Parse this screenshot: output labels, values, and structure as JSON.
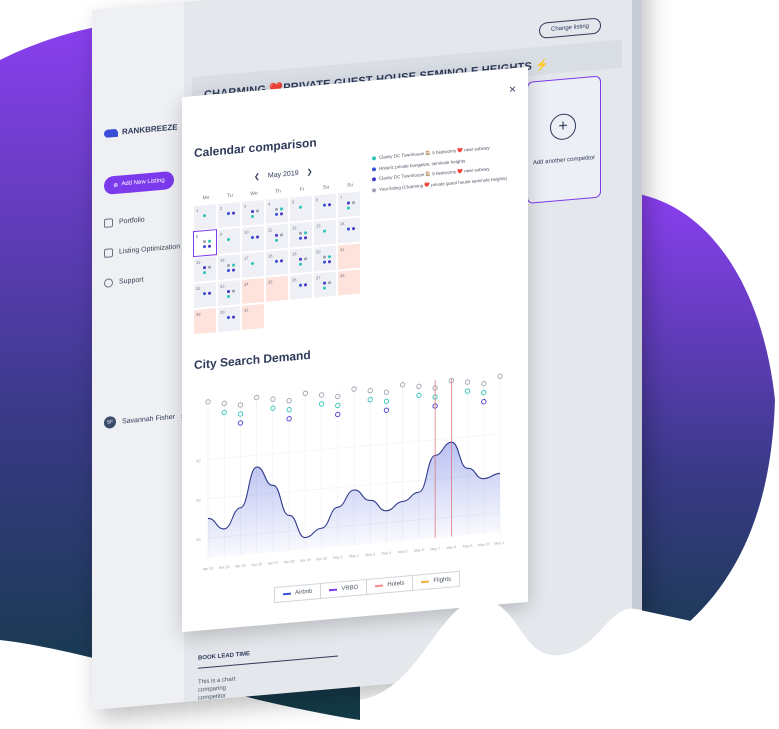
{
  "colors": {
    "purple_blob": "#7c3aed",
    "dark_blob": "#1e3a4a",
    "accent": "#7c3aed",
    "text": "#2e3a59",
    "booked": "#fde3dc",
    "dot_teal": "#2ec4b6",
    "dot_blue": "#3a4fd8",
    "dot_indigo": "#4338ca",
    "dot_gray": "#9ca3af"
  },
  "app": {
    "brand": "RANKBREEZE",
    "listing_title": "CHARMING ❤️PRIVATE GUEST HOUSE SEMINOLE HEIGHTS ⚡",
    "change_listing": "Change listing",
    "add_competitor": "Add another competitor"
  },
  "sidebar": {
    "add_listing": "Add New Listing",
    "items": [
      {
        "label": "Portfolio",
        "icon": "home-icon"
      },
      {
        "label": "Listing Optimization",
        "icon": "trend-icon"
      },
      {
        "label": "Support",
        "icon": "help-icon"
      }
    ],
    "user": {
      "initials": "SF",
      "name": "Savannah Fisher"
    }
  },
  "book_lead": {
    "title": "BOOK LEAD TIME",
    "text": "This is a chart comparing competitor with your listing."
  },
  "modal": {
    "close": "×",
    "calendar_title": "Calendar comparison",
    "month_label": "May 2019",
    "prev": "❮",
    "next": "❯",
    "weekdays": [
      "Mo",
      "Tu",
      "We",
      "Th",
      "Fr",
      "Sa",
      "Su"
    ],
    "days": [
      {
        "n": "1",
        "s": "p"
      },
      {
        "n": "2",
        "s": "p"
      },
      {
        "n": "3",
        "s": "p"
      },
      {
        "n": "4",
        "s": "p"
      },
      {
        "n": "5",
        "s": "p"
      },
      {
        "n": "6",
        "s": "p"
      },
      {
        "n": "7",
        "s": "p"
      },
      {
        "n": "8",
        "s": "sel"
      },
      {
        "n": "9",
        "s": "p"
      },
      {
        "n": "10",
        "s": "p"
      },
      {
        "n": "11",
        "s": "p"
      },
      {
        "n": "12",
        "s": "p"
      },
      {
        "n": "13",
        "s": "p"
      },
      {
        "n": "14",
        "s": "p"
      },
      {
        "n": "15",
        "s": "p"
      },
      {
        "n": "16",
        "s": "p"
      },
      {
        "n": "17",
        "s": "p"
      },
      {
        "n": "18",
        "s": "p"
      },
      {
        "n": "19",
        "s": "p"
      },
      {
        "n": "20",
        "s": "p"
      },
      {
        "n": "21",
        "s": "b"
      },
      {
        "n": "22",
        "s": "p"
      },
      {
        "n": "23",
        "s": "p"
      },
      {
        "n": "24",
        "s": "b"
      },
      {
        "n": "25",
        "s": "b"
      },
      {
        "n": "26",
        "s": "p"
      },
      {
        "n": "27",
        "s": "p"
      },
      {
        "n": "28",
        "s": "b"
      },
      {
        "n": "29",
        "s": "b"
      },
      {
        "n": "30",
        "s": "p"
      },
      {
        "n": "31",
        "s": "b"
      },
      {
        "n": "",
        "s": "e"
      },
      {
        "n": "",
        "s": "e"
      },
      {
        "n": "",
        "s": "e"
      },
      {
        "n": "",
        "s": "e"
      }
    ],
    "legend": [
      {
        "label": "Classy DC Townhouse 🏠 5 bedrooms ❤️ near subway",
        "color": "#2ec4b6"
      },
      {
        "label": "Historic private bungalow, seminole heights",
        "color": "#3a4fd8"
      },
      {
        "label": "Classy DC Townhouse 🏠 5 bedrooms ❤️ near subway",
        "color": "#4338ca"
      },
      {
        "label": "Your listing (Charming ❤️ private guest house seminole heights)",
        "color": "#9ca3af"
      }
    ],
    "demand_title": "City Search Demand",
    "toggles": [
      {
        "label": "Airbnb",
        "color": "#3a4fd8"
      },
      {
        "label": "VRBO",
        "color": "#7c3aed"
      },
      {
        "label": "Hotels",
        "color": "#f28b82"
      },
      {
        "label": "Flights",
        "color": "#f5b041"
      }
    ]
  },
  "chart_data": {
    "type": "area",
    "title": "City Search Demand",
    "x": [
      "Apr 23",
      "Apr 24",
      "Apr 25",
      "Apr 26",
      "Apr 27",
      "Apr 28",
      "Apr 29",
      "Apr 30",
      "May 1",
      "May 2",
      "May 3",
      "May 4",
      "May 5",
      "May 6",
      "May 7",
      "May 8",
      "May 9",
      "May 10",
      "May 11"
    ],
    "y_ticks": [
      10,
      20,
      30
    ],
    "ylim": [
      5,
      35
    ],
    "series": [
      {
        "name": "Airbnb",
        "values": [
          15,
          12,
          17,
          27,
          22,
          14,
          8,
          10,
          15,
          19,
          16,
          13,
          15,
          17,
          26,
          29,
          22,
          19,
          20
        ]
      }
    ],
    "markers": [
      "May 7",
      "May 8"
    ]
  }
}
